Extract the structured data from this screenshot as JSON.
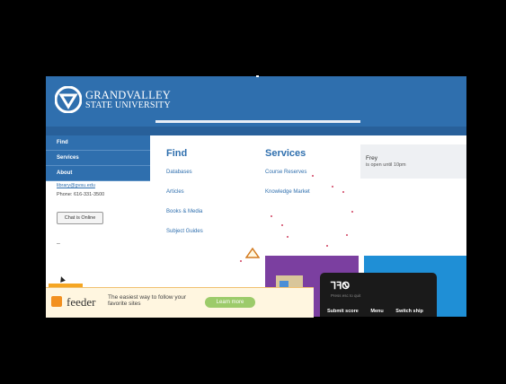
{
  "header": {
    "brand_line1": "GRANDVALLEY",
    "brand_line2": "STATE UNIVERSITY",
    "logo_icon": "gvsu-logo-icon"
  },
  "sidebar": {
    "items": [
      {
        "label": "Find"
      },
      {
        "label": "Services"
      },
      {
        "label": "About"
      }
    ],
    "email": "library@gvsu.edu",
    "phone": "Phone: 616-331-3500",
    "chat_button": "Chat is Online",
    "dash": "–"
  },
  "find": {
    "title": "Find",
    "links": [
      "Databases",
      "Articles",
      "Books & Media",
      "Subject Guides"
    ]
  },
  "services": {
    "title": "Services",
    "links": [
      "Course Reserves",
      "Knowledge Market"
    ]
  },
  "hours": {
    "name": "Frey",
    "status": "is open until 10pm"
  },
  "feeder": {
    "name": "feeder",
    "tagline": "The easiest way to follow your favorite sites",
    "cta": "Learn more",
    "rss_icon": "rss-icon"
  },
  "dark_panel": {
    "icon_text": "ꞀꟻᏫ",
    "subtext": "Press esc to quit",
    "actions": [
      "Submit score",
      "Menu",
      "Switch ship"
    ]
  },
  "colors": {
    "gvsu_blue": "#2f6fae",
    "feeder_orange": "#f29020",
    "purple_tile": "#7b3fa0",
    "blue_tile": "#1f8fd6"
  }
}
